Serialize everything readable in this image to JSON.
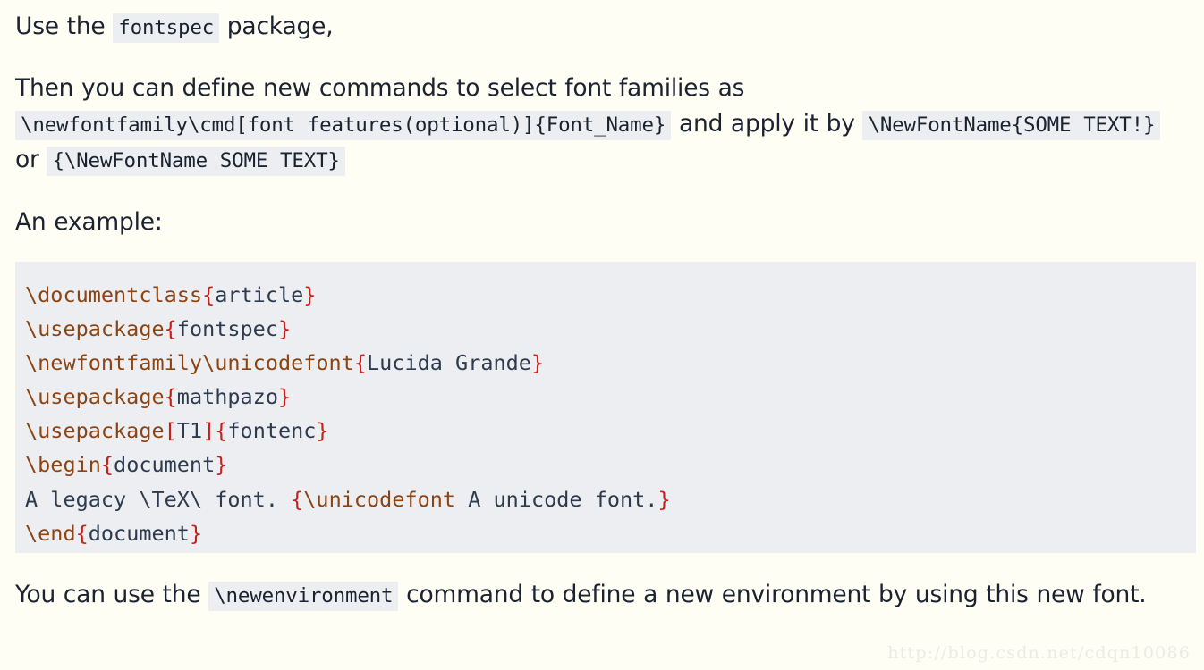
{
  "page": {
    "background_color": "#fefef5",
    "text_color": "#1c2330",
    "inline_code_background": "#eceef2",
    "code_block_background": "#eceef1",
    "code_command_color": "#8b4413",
    "code_brace_color": "#c7211b",
    "code_text_color": "#2e3b4e",
    "watermark_color": "#ebebe4"
  },
  "paragraph1": {
    "text_before": "Use the",
    "code": "fontspec",
    "text_after": "package,"
  },
  "paragraph2": {
    "part1": "Then you can define new commands to select font families as",
    "code1": "\\newfontfamily\\cmd[font features(optional)]{Font_Name}",
    "part2": "and apply it by",
    "code2": "\\NewFontName{SOME TEXT!}",
    "part3": "or",
    "code3": "{\\NewFontName SOME TEXT}"
  },
  "paragraph3": {
    "text": "An example:"
  },
  "code_block": {
    "language": "latex",
    "lines": [
      {
        "tokens": [
          {
            "t": "\\documentclass",
            "c": "cmd"
          },
          {
            "t": "{",
            "c": "brc"
          },
          {
            "t": "article",
            "c": "txt"
          },
          {
            "t": "}",
            "c": "brc"
          }
        ]
      },
      {
        "tokens": [
          {
            "t": "\\usepackage",
            "c": "cmd"
          },
          {
            "t": "{",
            "c": "brc"
          },
          {
            "t": "fontspec",
            "c": "txt"
          },
          {
            "t": "}",
            "c": "brc"
          }
        ]
      },
      {
        "tokens": [
          {
            "t": "\\newfontfamily\\unicodefont",
            "c": "cmd"
          },
          {
            "t": "{",
            "c": "brc"
          },
          {
            "t": "Lucida Grande",
            "c": "txt"
          },
          {
            "t": "}",
            "c": "brc"
          }
        ]
      },
      {
        "tokens": [
          {
            "t": "\\usepackage",
            "c": "cmd"
          },
          {
            "t": "{",
            "c": "brc"
          },
          {
            "t": "mathpazo",
            "c": "txt"
          },
          {
            "t": "}",
            "c": "brc"
          }
        ]
      },
      {
        "tokens": [
          {
            "t": "\\usepackage",
            "c": "cmd"
          },
          {
            "t": "[",
            "c": "brc"
          },
          {
            "t": "T1",
            "c": "txt"
          },
          {
            "t": "]",
            "c": "brc"
          },
          {
            "t": "{",
            "c": "brc"
          },
          {
            "t": "fontenc",
            "c": "txt"
          },
          {
            "t": "}",
            "c": "brc"
          }
        ]
      },
      {
        "tokens": [
          {
            "t": "\\begin",
            "c": "cmd"
          },
          {
            "t": "{",
            "c": "brc"
          },
          {
            "t": "document",
            "c": "txt"
          },
          {
            "t": "}",
            "c": "brc"
          }
        ]
      },
      {
        "tokens": [
          {
            "t": "A legacy \\TeX\\ font. ",
            "c": "txt"
          },
          {
            "t": "{",
            "c": "brc"
          },
          {
            "t": "\\unicodefont",
            "c": "cmd"
          },
          {
            "t": " A unicode font.",
            "c": "txt"
          },
          {
            "t": "}",
            "c": "brc"
          }
        ]
      },
      {
        "tokens": [
          {
            "t": "\\end",
            "c": "cmd"
          },
          {
            "t": "{",
            "c": "brc"
          },
          {
            "t": "document",
            "c": "txt"
          },
          {
            "t": "}",
            "c": "brc"
          }
        ]
      }
    ],
    "plain_text": "\\documentclass{article}\n\\usepackage{fontspec}\n\\newfontfamily\\unicodefont{Lucida Grande}\n\\usepackage{mathpazo}\n\\usepackage[T1]{fontenc}\n\\begin{document}\nA legacy \\TeX\\ font. {\\unicodefont A unicode font.}\n\\end{document}"
  },
  "paragraph4": {
    "part1": "You can use the",
    "code1": "\\newenvironment",
    "part2": "command to define a new environment by using this new font."
  },
  "watermark": {
    "text": "http://blog.csdn.net/cdqn10086"
  }
}
